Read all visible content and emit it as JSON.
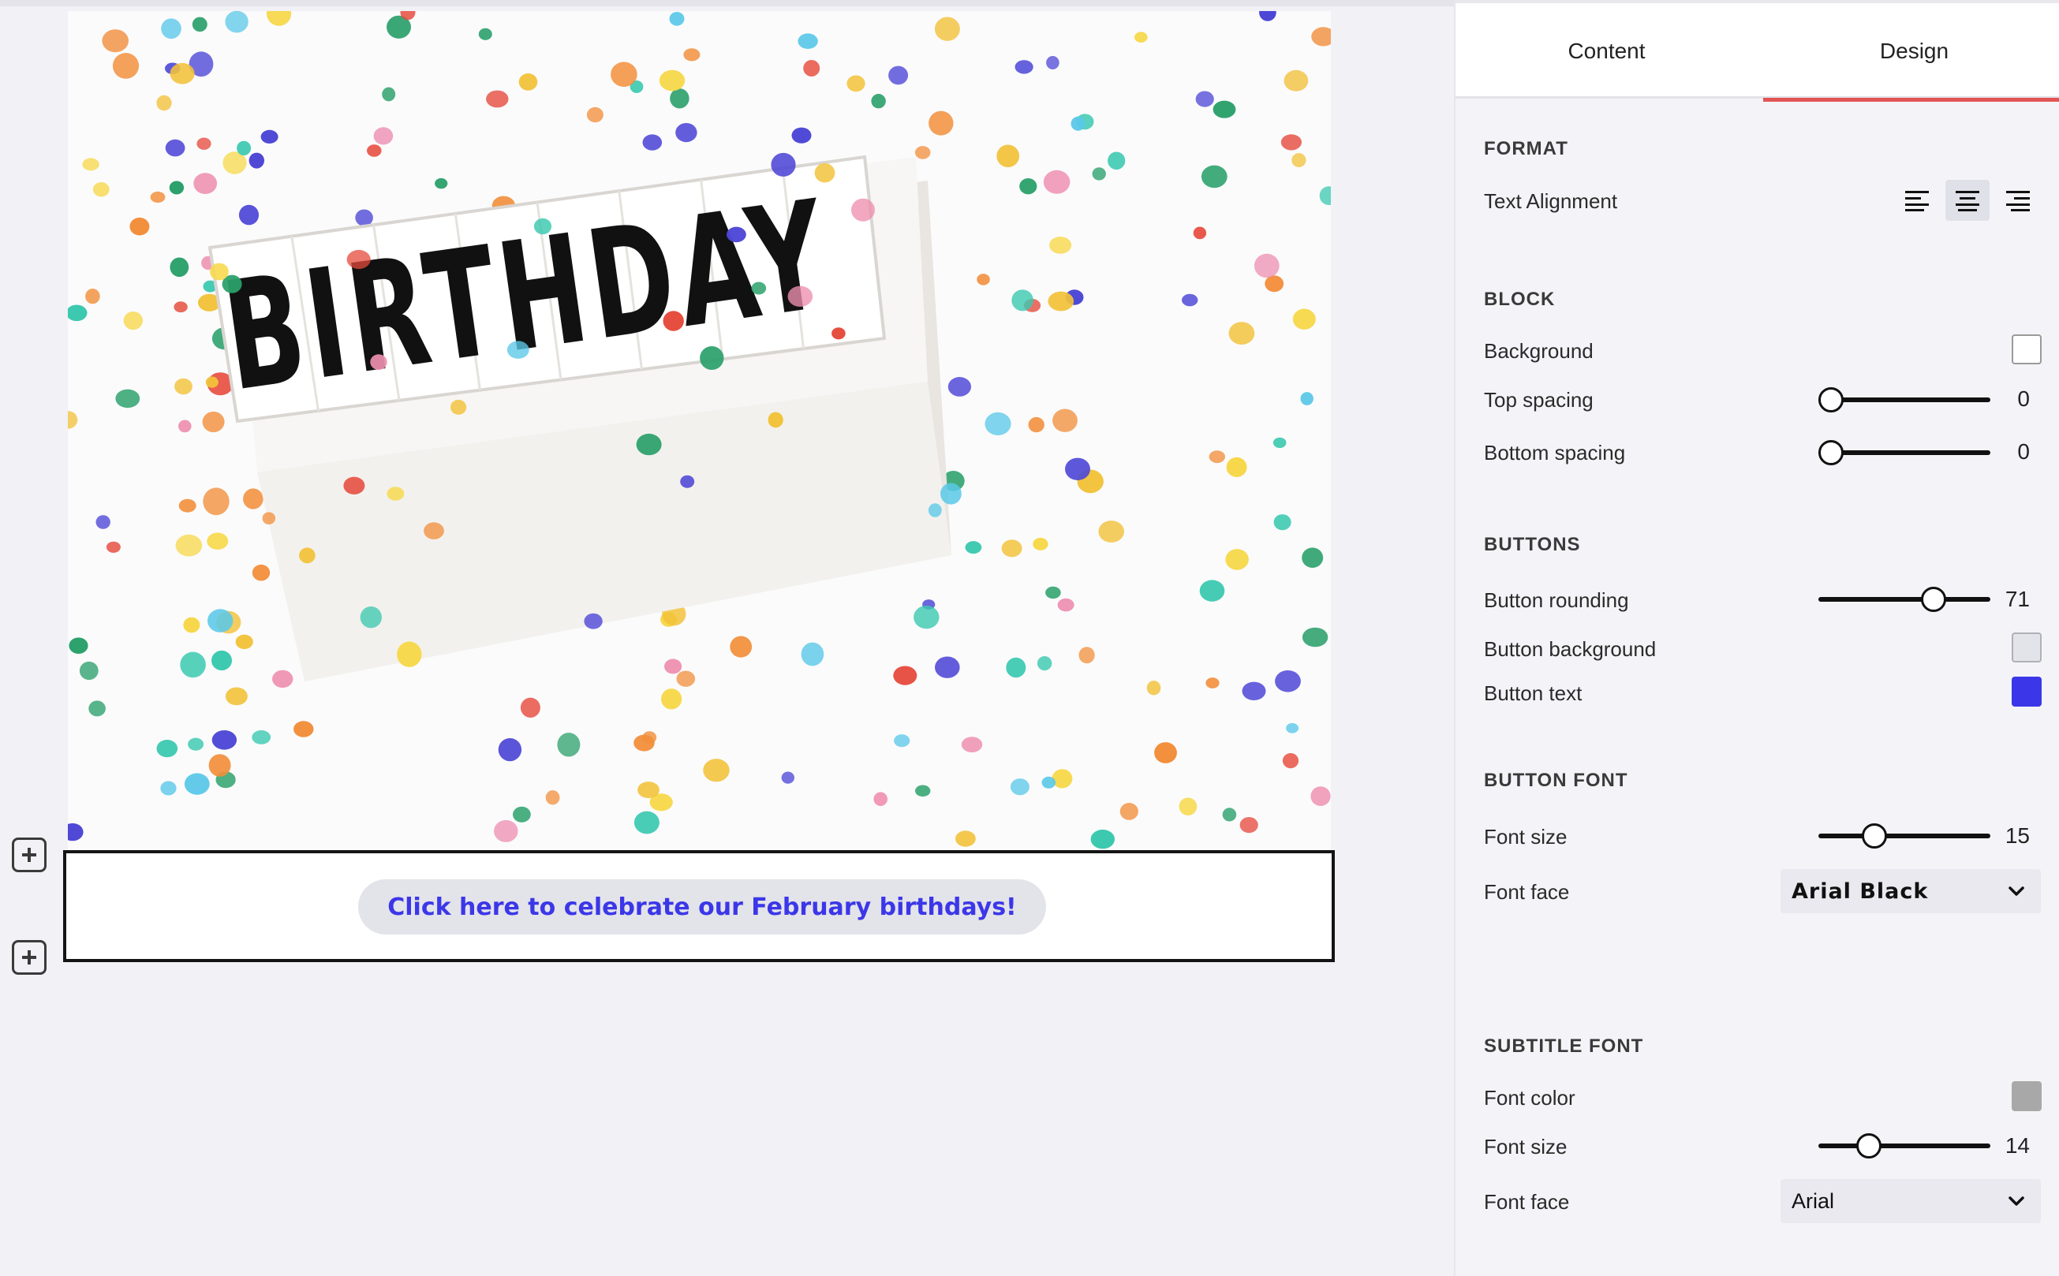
{
  "tabs": {
    "content": "Content",
    "design": "Design",
    "active": "Design"
  },
  "hero": {
    "sign_text": "BIRTHDAY",
    "confetti_colors": [
      "#f2c23a",
      "#e64a3c",
      "#4d47d6",
      "#3cc9b0",
      "#f28f3b",
      "#ee8fb0",
      "#2aa06a",
      "#5bc8e8",
      "#f7d84a"
    ]
  },
  "cta": {
    "label": "Click here to celebrate our February birthdays!"
  },
  "format": {
    "title": "FORMAT",
    "text_alignment_label": "Text Alignment",
    "alignment_options": [
      "left",
      "center",
      "right"
    ],
    "alignment_selected": "center"
  },
  "block": {
    "title": "BLOCK",
    "background_label": "Background",
    "background_color": "#ffffff",
    "top_spacing_label": "Top spacing",
    "top_spacing": "0",
    "bottom_spacing_label": "Bottom spacing",
    "bottom_spacing": "0"
  },
  "buttons": {
    "title": "BUTTONS",
    "rounding_label": "Button rounding",
    "rounding": "71",
    "background_label": "Button background",
    "background_color": "#e3e3ea",
    "text_label": "Button text",
    "text_color": "#3b37e8"
  },
  "button_font": {
    "title": "BUTTON FONT",
    "size_label": "Font size",
    "size": "15",
    "face_label": "Font face",
    "face": "Arial Black"
  },
  "subtitle_font": {
    "title": "SUBTITLE FONT",
    "color_label": "Font color",
    "color": "#a8a8a8",
    "size_label": "Font size",
    "size": "14",
    "face_label": "Font face",
    "face": "Arial"
  }
}
